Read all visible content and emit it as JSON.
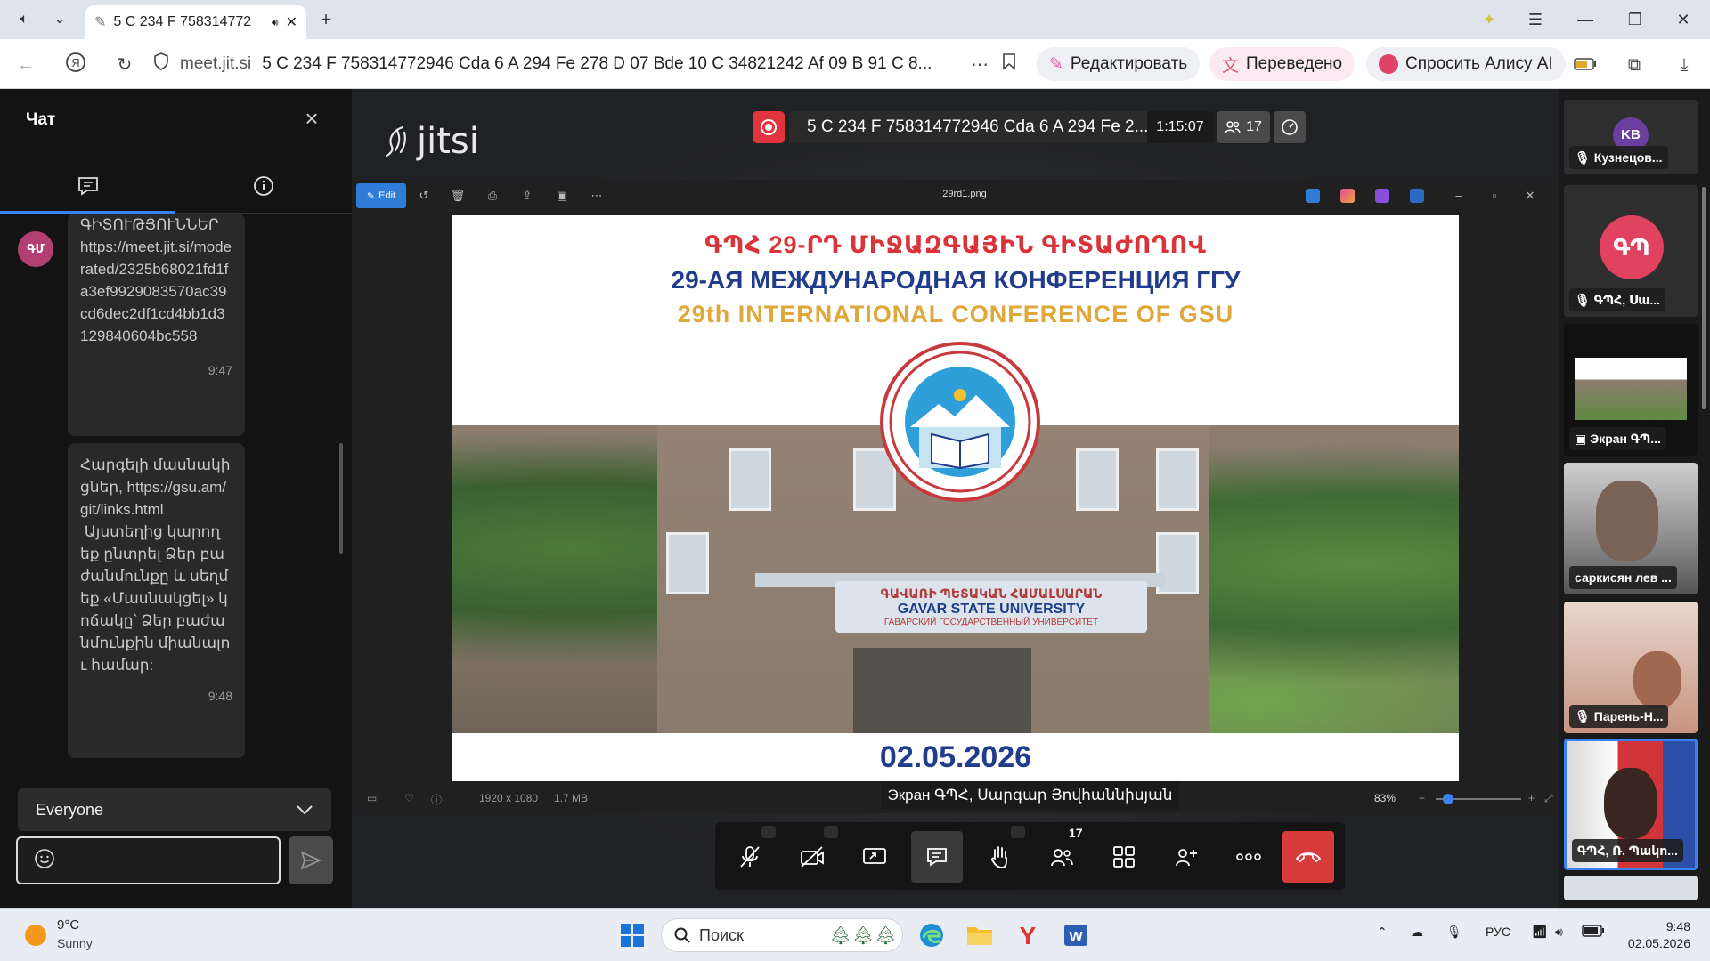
{
  "browser": {
    "tab_title": "5 C 234 F 758314772",
    "url_domain": "meet.jit.si",
    "url_path": "5 C 234 F 758314772946 Cda 6 A 294 Fe 278 D 07 Bde 10 C 34821242 Af 09 B 91 C 8...",
    "edit_label": "Редактировать",
    "translated_label": "Переведено",
    "alice_label": "Спросить Алису AI"
  },
  "chat": {
    "title": "Чат",
    "avatar": "ԳՄ",
    "messages": [
      {
        "text": "ԳԻՏՈՒԹՅՈՒՆՆԵՐ\nhttps://meet.jit.si/moderated/2325b68021fd1fa3ef9929083570ac39cd6dec2df1cd4bb1d3129840604bc558",
        "time": "9:47"
      },
      {
        "text": "Հարգելի մասնակիցներ, https://gsu.am/git/links.html\n Այստեղից կարող եք ընտրել Ձեր բաժանմունքը և սեղմեք «Մասնակցել» կոճակը՝ Ձեր բաժանմունքին միանալու համար:",
        "time": "9:48"
      }
    ],
    "recipient": "Everyone"
  },
  "meeting": {
    "logo_text": "jitsi",
    "name": "5 C 234 F 758314772946 Cda 6 A 294 Fe 2...",
    "timer": "1:15:07",
    "participants": "17"
  },
  "viewer": {
    "edit_label": "Edit",
    "file_name": "29rd1.png",
    "dimensions": "1920 x 1080",
    "file_size": "1.7 MB",
    "zoom": "83%"
  },
  "slide": {
    "line_arm": "ԳՊՀ 29-ՐԴ ՄԻՋԱԶԳԱՅԻՆ ԳԻՏԱԺՈՂՈՎ",
    "line_ru": "29-АЯ МЕЖДУНАРОДНАЯ КОНФЕРЕНЦИЯ ГГУ",
    "line_en": "29th INTERNATIONAL CONFERENCE OF GSU",
    "sign_arm": "ԳԱՎԱՌԻ ՊԵՏԱԿԱՆ ՀԱՄԱԼՍԱՐԱՆ",
    "sign_en": "GAVAR STATE UNIVERSITY",
    "sign_ru": "ГАВАРСКИЙ ГОСУДАРСТВЕННЫЙ УНИВЕРСИТЕТ",
    "date": "02.05.2026"
  },
  "caption": "Экран ԳՊՀ, Սարգար Յովհաննիսյան",
  "toolbar": {
    "participants_badge": "17"
  },
  "filmstrip": [
    {
      "initials": "KB",
      "name": "Кузнецов...",
      "color": "#6b3fa0"
    },
    {
      "initials": "ԳՊ",
      "name": "ԳՊՀ, Սա...",
      "color": "#e0425f"
    },
    {
      "initials": "",
      "name": "Экран ԳՊ...",
      "color": ""
    },
    {
      "initials": "",
      "name": "саркисян лев ...",
      "color": ""
    },
    {
      "initials": "",
      "name": "Парень-Н...",
      "color": ""
    },
    {
      "initials": "",
      "name": "ԳՊՀ, Ռ. Պակո...",
      "color": ""
    }
  ],
  "taskbar": {
    "temp": "9°C",
    "weather": "Sunny",
    "search_placeholder": "Поиск",
    "lang": "РУС",
    "time": "9:48",
    "date": "02.05.2026"
  }
}
